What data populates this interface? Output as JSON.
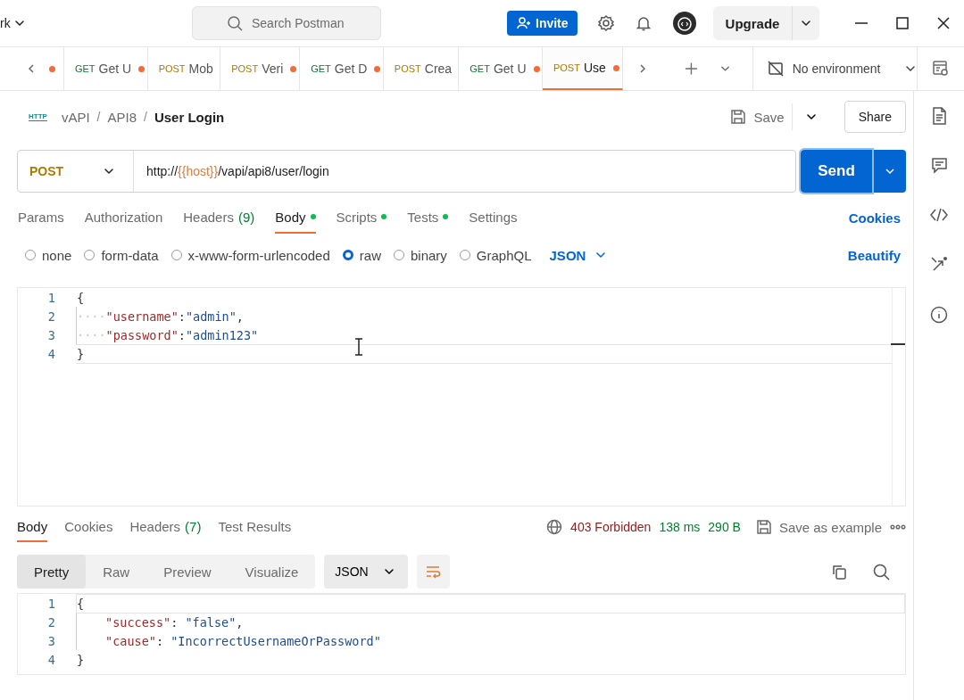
{
  "titlebar": {
    "workspace": "rk",
    "search_placeholder": "Search Postman",
    "invite": "Invite",
    "upgrade": "Upgrade"
  },
  "tabs": {
    "partial_unsaved": true,
    "items": [
      {
        "method": "GET",
        "name": "Get U",
        "unsaved": true,
        "selected": false
      },
      {
        "method": "POST",
        "name": "Mob",
        "unsaved": false,
        "selected": false
      },
      {
        "method": "POST",
        "name": "Veri",
        "unsaved": true,
        "selected": false
      },
      {
        "method": "GET",
        "name": "Get D",
        "unsaved": true,
        "selected": false
      },
      {
        "method": "POST",
        "name": "Crea",
        "unsaved": false,
        "selected": false
      },
      {
        "method": "GET",
        "name": "Get U",
        "unsaved": true,
        "selected": false
      },
      {
        "method": "POST",
        "name": "Use",
        "unsaved": true,
        "selected": true
      }
    ],
    "environment": "No environment"
  },
  "request": {
    "protocol": "HTTP",
    "breadcrumb": [
      {
        "text": "vAPI",
        "kind": "link"
      },
      {
        "text": "/",
        "kind": "separator"
      },
      {
        "text": "API8",
        "kind": "link"
      },
      {
        "text": "/",
        "kind": "separator"
      }
    ],
    "title": "User Login",
    "save": "Save",
    "share": "Share",
    "method": "POST",
    "url": [
      {
        "text": "http://",
        "kind": "text"
      },
      {
        "text": "{{host}}",
        "kind": "variable"
      },
      {
        "text": "/vapi/api8/user/login",
        "kind": "text"
      }
    ],
    "send": "Send",
    "tabs": [
      {
        "label": "Params",
        "selected": false,
        "dot": false
      },
      {
        "label": "Authorization",
        "selected": false,
        "dot": false
      },
      {
        "label": "Headers",
        "count": "(9)",
        "selected": false,
        "dot": false
      },
      {
        "label": "Body",
        "selected": true,
        "dot": true
      },
      {
        "label": "Scripts",
        "selected": false,
        "dot": true
      },
      {
        "label": "Tests",
        "selected": false,
        "dot": true
      },
      {
        "label": "Settings",
        "selected": false,
        "dot": false
      }
    ],
    "cookies": "Cookies",
    "body_types": [
      {
        "label": "none",
        "selected": false
      },
      {
        "label": "form-data",
        "selected": false
      },
      {
        "label": "x-www-form-urlencoded",
        "selected": false
      },
      {
        "label": "raw",
        "selected": true
      },
      {
        "label": "binary",
        "selected": false
      },
      {
        "label": "GraphQL",
        "selected": false
      }
    ],
    "format": "JSON",
    "beautify": "Beautify",
    "lines": [
      {
        "number": "1",
        "indented": false,
        "tokens": [
          {
            "text": "{",
            "kind": "punct"
          }
        ]
      },
      {
        "number": "2",
        "indented": true,
        "tokens": [
          {
            "text": "····",
            "kind": "whitespace"
          },
          {
            "text": "\"username\"",
            "kind": "key"
          },
          {
            "text": ":",
            "kind": "punct"
          },
          {
            "text": "\"admin\"",
            "kind": "string"
          },
          {
            "text": ",",
            "kind": "punct"
          }
        ]
      },
      {
        "number": "3",
        "indented": true,
        "tokens": [
          {
            "text": "····",
            "kind": "whitespace"
          },
          {
            "text": "\"password\"",
            "kind": "key"
          },
          {
            "text": ":",
            "kind": "punct"
          },
          {
            "text": "\"admin123\"",
            "kind": "string"
          }
        ]
      },
      {
        "number": "4",
        "indented": false,
        "tokens": [
          {
            "text": "}",
            "kind": "punct"
          }
        ]
      }
    ]
  },
  "response": {
    "tabs": [
      {
        "label": "Body",
        "selected": true
      },
      {
        "label": "Cookies",
        "selected": false
      },
      {
        "label": "Headers",
        "count": "(7)",
        "selected": false
      },
      {
        "label": "Test Results",
        "selected": false
      }
    ],
    "status": "403 Forbidden",
    "time": "138 ms",
    "size": "290 B",
    "save_example": "Save as example",
    "views": [
      {
        "label": "Pretty",
        "selected": true
      },
      {
        "label": "Raw",
        "selected": false
      },
      {
        "label": "Preview",
        "selected": false
      },
      {
        "label": "Visualize",
        "selected": false
      }
    ],
    "format": "JSON",
    "lines": [
      {
        "number": "1",
        "indented": false,
        "tokens": [
          {
            "text": "{",
            "kind": "punct"
          }
        ]
      },
      {
        "number": "2",
        "indented": true,
        "tokens": [
          {
            "text": "\"success\"",
            "kind": "key"
          },
          {
            "text": ": ",
            "kind": "punct"
          },
          {
            "text": "\"false\"",
            "kind": "string"
          },
          {
            "text": ",",
            "kind": "punct"
          }
        ]
      },
      {
        "number": "3",
        "indented": true,
        "tokens": [
          {
            "text": "\"cause\"",
            "kind": "key"
          },
          {
            "text": ": ",
            "kind": "punct"
          },
          {
            "text": "\"IncorrectUsernameOrPassword\"",
            "kind": "string"
          }
        ]
      },
      {
        "number": "4",
        "indented": false,
        "tokens": [
          {
            "text": "}",
            "kind": "punct"
          }
        ]
      }
    ]
  }
}
